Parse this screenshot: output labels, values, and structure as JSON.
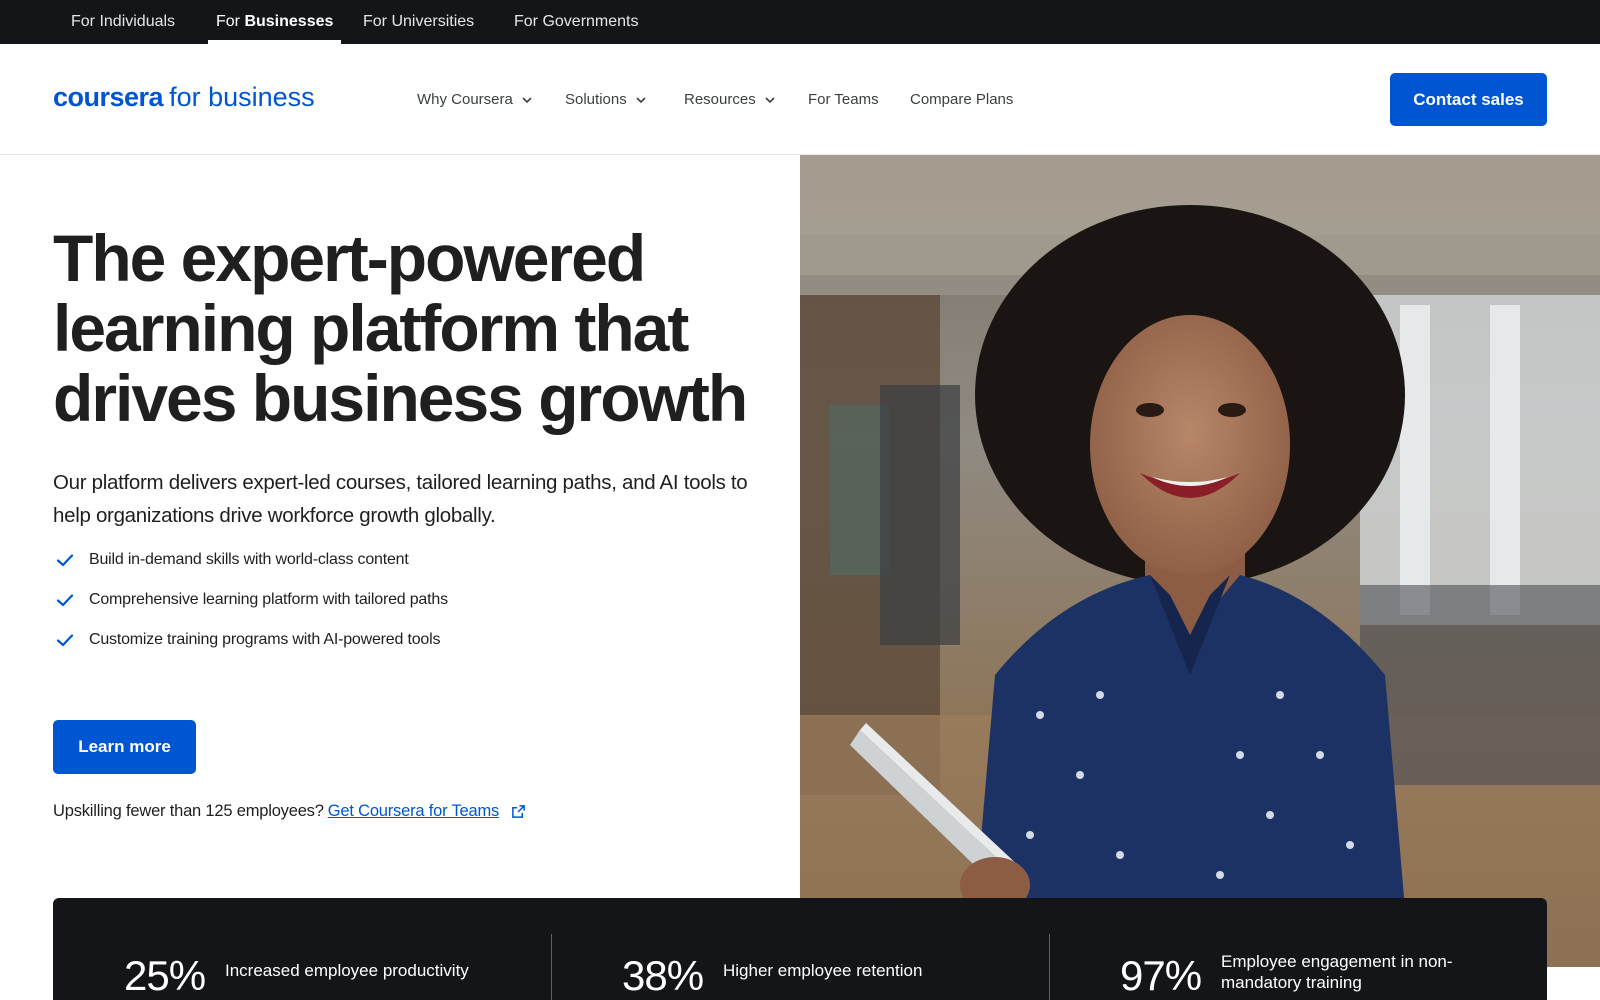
{
  "audience_nav": [
    {
      "prefix": "For",
      "label": "Individuals",
      "active": false
    },
    {
      "prefix": "For",
      "label": "Businesses",
      "active": true
    },
    {
      "prefix": "For",
      "label": "Universities",
      "active": false
    },
    {
      "prefix": "For",
      "label": "Governments",
      "active": false
    }
  ],
  "header": {
    "logo_word": "coursera",
    "logo_suffix": "for business",
    "nav": [
      {
        "label": "Why Coursera",
        "dropdown": true
      },
      {
        "label": "Solutions",
        "dropdown": true
      },
      {
        "label": "Resources",
        "dropdown": true
      },
      {
        "label": "For Teams",
        "dropdown": false
      },
      {
        "label": "Compare Plans",
        "dropdown": false
      }
    ],
    "contact_label": "Contact sales"
  },
  "hero": {
    "title_line1": "The expert-powered",
    "title_line2": "learning platform that",
    "title_line3": "drives business growth",
    "description": "Our platform delivers expert-led courses, tailored learning paths, and AI tools to help organizations drive workforce growth globally.",
    "features": [
      "Build in-demand skills with world-class content",
      "Comprehensive learning platform with tailored paths",
      "Customize training programs with AI-powered tools"
    ],
    "cta_label": "Learn more",
    "teams_prompt": "Upskilling fewer than 125 employees?",
    "teams_link": "Get Coursera for Teams",
    "icons": {
      "check": "check-icon",
      "external": "external-link-icon",
      "chevron": "chevron-down-icon"
    }
  },
  "stats": [
    {
      "value": "25%",
      "label": "Increased employee productivity"
    },
    {
      "value": "38%",
      "label": "Higher employee retention"
    },
    {
      "value": "97%",
      "label": "Employee engagement in non-mandatory training"
    }
  ],
  "colors": {
    "brand": "#0056d2",
    "dark": "#141518",
    "text": "#1f1f1f"
  }
}
